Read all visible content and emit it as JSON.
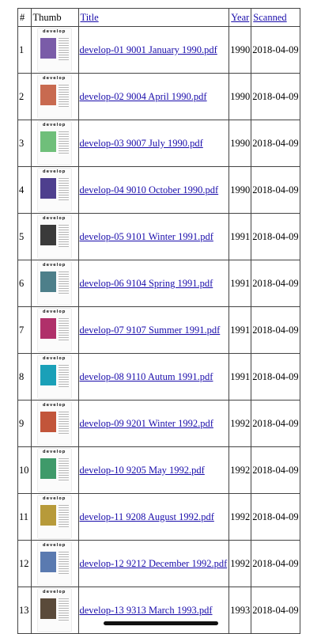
{
  "table": {
    "headers": {
      "num": "#",
      "thumb": "Thumb",
      "title": "Title",
      "year": "Year",
      "scanned": "Scanned"
    },
    "rows": [
      {
        "num": "1",
        "title": "develop-01 9001 January 1990.pdf",
        "year": "1990",
        "scanned": "2018-04-09",
        "cover_color": "#7a5ca8"
      },
      {
        "num": "2",
        "title": "develop-02 9004 April 1990.pdf",
        "year": "1990",
        "scanned": "2018-04-09",
        "cover_color": "#c86a50"
      },
      {
        "num": "3",
        "title": "develop-03 9007 July 1990.pdf",
        "year": "1990",
        "scanned": "2018-04-09",
        "cover_color": "#6fbf7a"
      },
      {
        "num": "4",
        "title": "develop-04 9010 October 1990.pdf",
        "year": "1990",
        "scanned": "2018-04-09",
        "cover_color": "#4e3f8e"
      },
      {
        "num": "5",
        "title": "develop-05 9101 Winter 1991.pdf",
        "year": "1991",
        "scanned": "2018-04-09",
        "cover_color": "#3a3a3a"
      },
      {
        "num": "6",
        "title": "develop-06 9104 Spring 1991.pdf",
        "year": "1991",
        "scanned": "2018-04-09",
        "cover_color": "#4d7f8a"
      },
      {
        "num": "7",
        "title": "develop-07 9107 Summer 1991.pdf",
        "year": "1991",
        "scanned": "2018-04-09",
        "cover_color": "#b0306a"
      },
      {
        "num": "8",
        "title": "develop-08 9110 Autum 1991.pdf",
        "year": "1991",
        "scanned": "2018-04-09",
        "cover_color": "#1aa0b8"
      },
      {
        "num": "9",
        "title": "develop-09 9201 Winter 1992.pdf",
        "year": "1992",
        "scanned": "2018-04-09",
        "cover_color": "#c2553a"
      },
      {
        "num": "10",
        "title": "develop-10 9205 May 1992.pdf",
        "year": "1992",
        "scanned": "2018-04-09",
        "cover_color": "#3f9a6a"
      },
      {
        "num": "11",
        "title": "develop-11 9208 August 1992.pdf",
        "year": "1992",
        "scanned": "2018-04-09",
        "cover_color": "#b79a3a"
      },
      {
        "num": "12",
        "title": "develop-12 9212 December 1992.pdf",
        "year": "1992",
        "scanned": "2018-04-09",
        "cover_color": "#5a7ab0"
      },
      {
        "num": "13",
        "title": "develop-13 9313 March 1993.pdf",
        "year": "1993",
        "scanned": "2018-04-09",
        "cover_color": "#5a4a3a"
      }
    ]
  },
  "cover_masthead": "develop"
}
